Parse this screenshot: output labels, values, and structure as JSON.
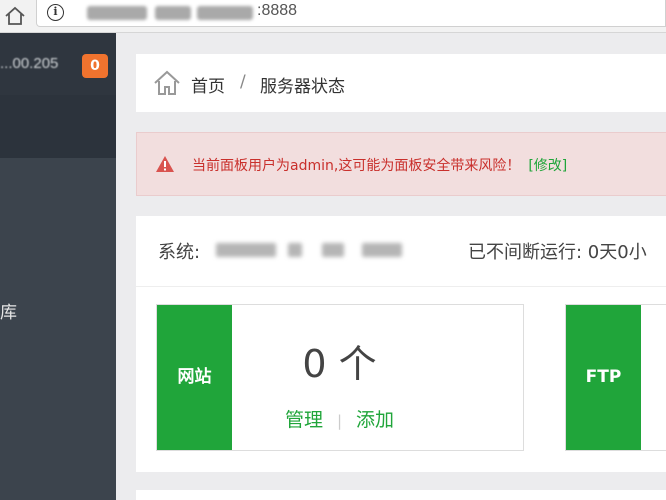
{
  "browser": {
    "url_port": ":8888"
  },
  "sidebar": {
    "server_ip": "...00.205",
    "badge_count": "0",
    "menu_item_partial": "库"
  },
  "breadcrumb": {
    "home": "首页",
    "separator": "/",
    "current": "服务器状态"
  },
  "alert": {
    "message": "当前面板用户为admin,这可能为面板安全带来风险！",
    "fix_link": "[修改]"
  },
  "status": {
    "system_label": "系统:",
    "uptime": "已不间断运行: 0天0小"
  },
  "cards": [
    {
      "tag": "网站",
      "count": "0 个",
      "manage": "管理",
      "divider": "|",
      "add": "添加"
    },
    {
      "tag": "FTP"
    }
  ],
  "colors": {
    "brand_green": "#20a53a",
    "badge_orange": "#f0732e",
    "alert_red": "#c9302c",
    "sidebar_bg": "#3c444d"
  }
}
